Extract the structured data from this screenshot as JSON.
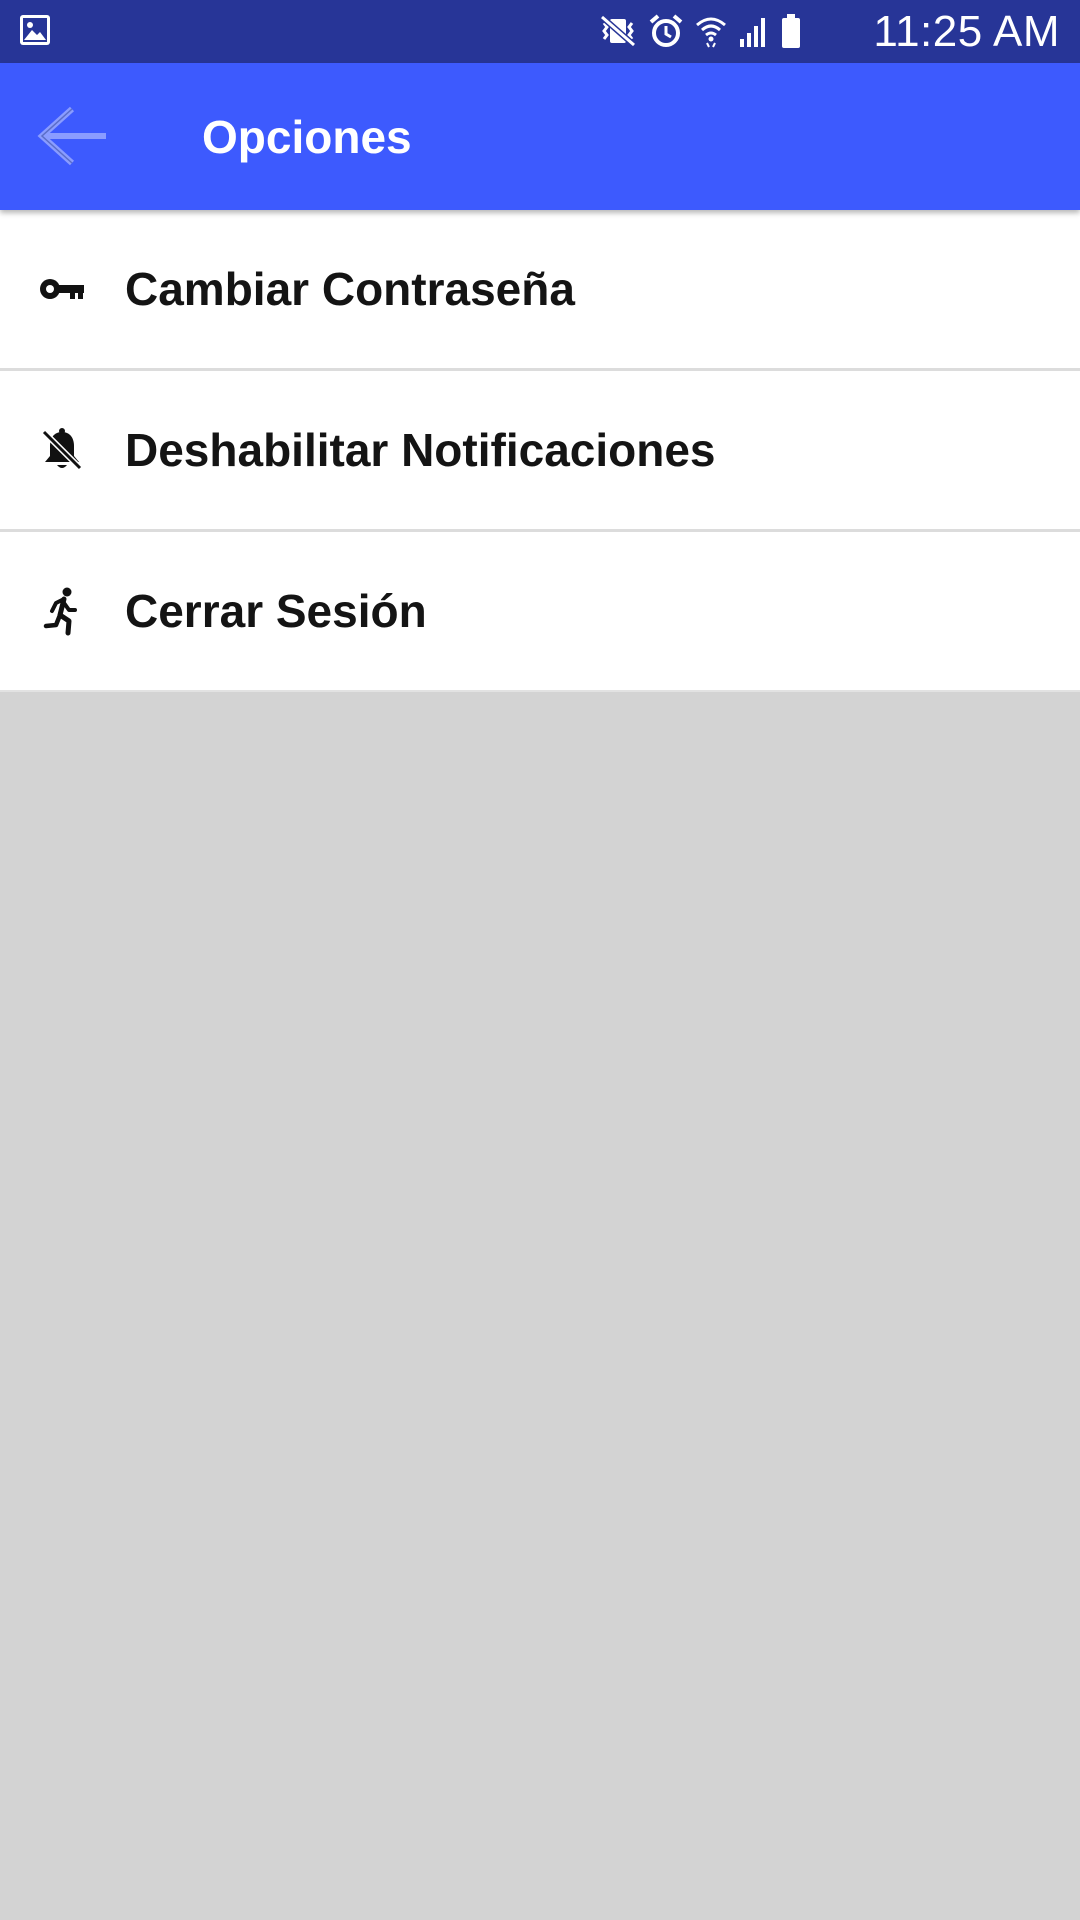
{
  "status_bar": {
    "time": "11:25 AM",
    "left_icons": [
      "gallery-icon"
    ],
    "right_icons": [
      "vibrate-mute-icon",
      "alarm-icon",
      "wifi-icon",
      "signal-icon",
      "battery-icon"
    ]
  },
  "app_bar": {
    "title": "Opciones",
    "back_icon": "arrow-back-icon"
  },
  "options": [
    {
      "label": "Cambiar Contraseña",
      "icon": "key-icon"
    },
    {
      "label": "Deshabilitar Notificaciones",
      "icon": "notifications-off-icon"
    },
    {
      "label": "Cerrar Sesión",
      "icon": "run-icon"
    }
  ],
  "colors": {
    "status_bar": "#273597",
    "app_bar": "#3d5afe",
    "list_background": "#ffffff",
    "page_background": "#d3d3d3",
    "divider": "#dcdcdc"
  }
}
